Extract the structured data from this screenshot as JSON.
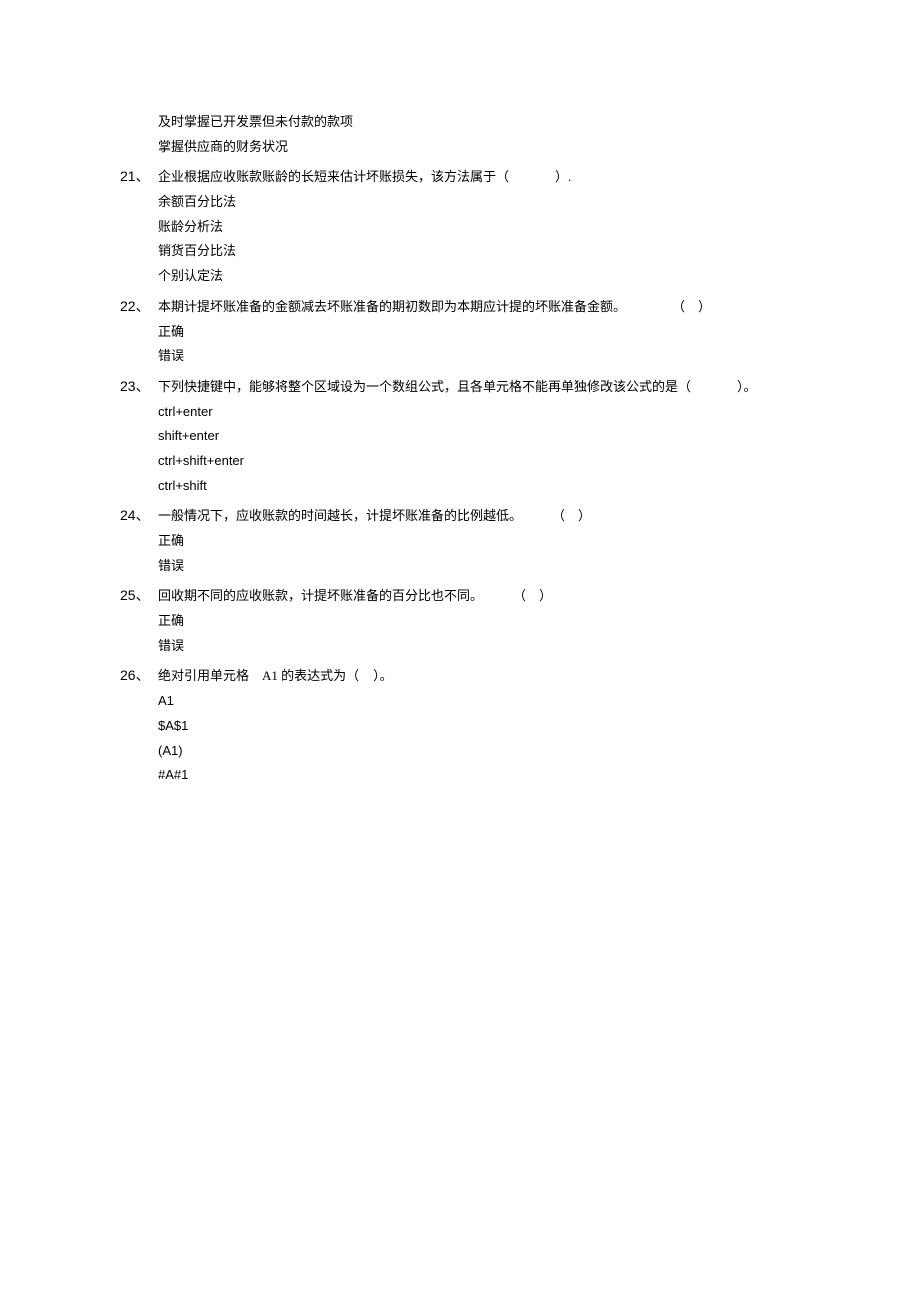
{
  "orphans": [
    "及时掌握已开发票但未付款的款项",
    "掌握供应商的财务状况"
  ],
  "questions": [
    {
      "num": "21、",
      "text_a": "企业根据应收账款账龄的长短来估计坏账损失，该方法属于（",
      "text_b": "）.",
      "gap": "gap-small",
      "options": [
        "余额百分比法",
        "账龄分析法",
        "销货百分比法",
        "个别认定法"
      ],
      "opt_class": ""
    },
    {
      "num": "22、",
      "text_a": "本期计提坏账准备的金额减去坏账准备的期初数即为本期应计提的坏账准备金额。",
      "text_b": "（ ）",
      "gap": "gap-small",
      "options": [
        "正确",
        "错误"
      ],
      "opt_class": ""
    },
    {
      "num": "23、",
      "text_a": "下列快捷键中，能够将整个区域设为一个数组公式，且各单元格不能再单独修改该公式的是（",
      "text_b": "）。",
      "gap": "gap-small",
      "options": [
        "ctrl+enter",
        "shift+enter",
        "ctrl+shift+enter",
        "ctrl+shift"
      ],
      "opt_class": "sans"
    },
    {
      "num": "24、",
      "text_a": "一般情况下，应收账款的时间越长，计提坏账准备的比例越低。",
      "text_b": "（ ）",
      "gap": "gap-med",
      "options": [
        "正确",
        "错误"
      ],
      "opt_class": ""
    },
    {
      "num": "25、",
      "text_a": "回收期不同的应收账款，计提坏账准备的百分比也不同。",
      "text_b": "（ ）",
      "gap": "gap-med",
      "options": [
        "正确",
        "错误"
      ],
      "opt_class": ""
    },
    {
      "num": "26、",
      "text_a": "绝对引用单元格 A1 的表达式为（",
      "text_b": "）。",
      "gap": "gap-tiny",
      "options": [
        "A1",
        "$A$1",
        "(A1)",
        "#A#1"
      ],
      "opt_class": "sans"
    }
  ]
}
